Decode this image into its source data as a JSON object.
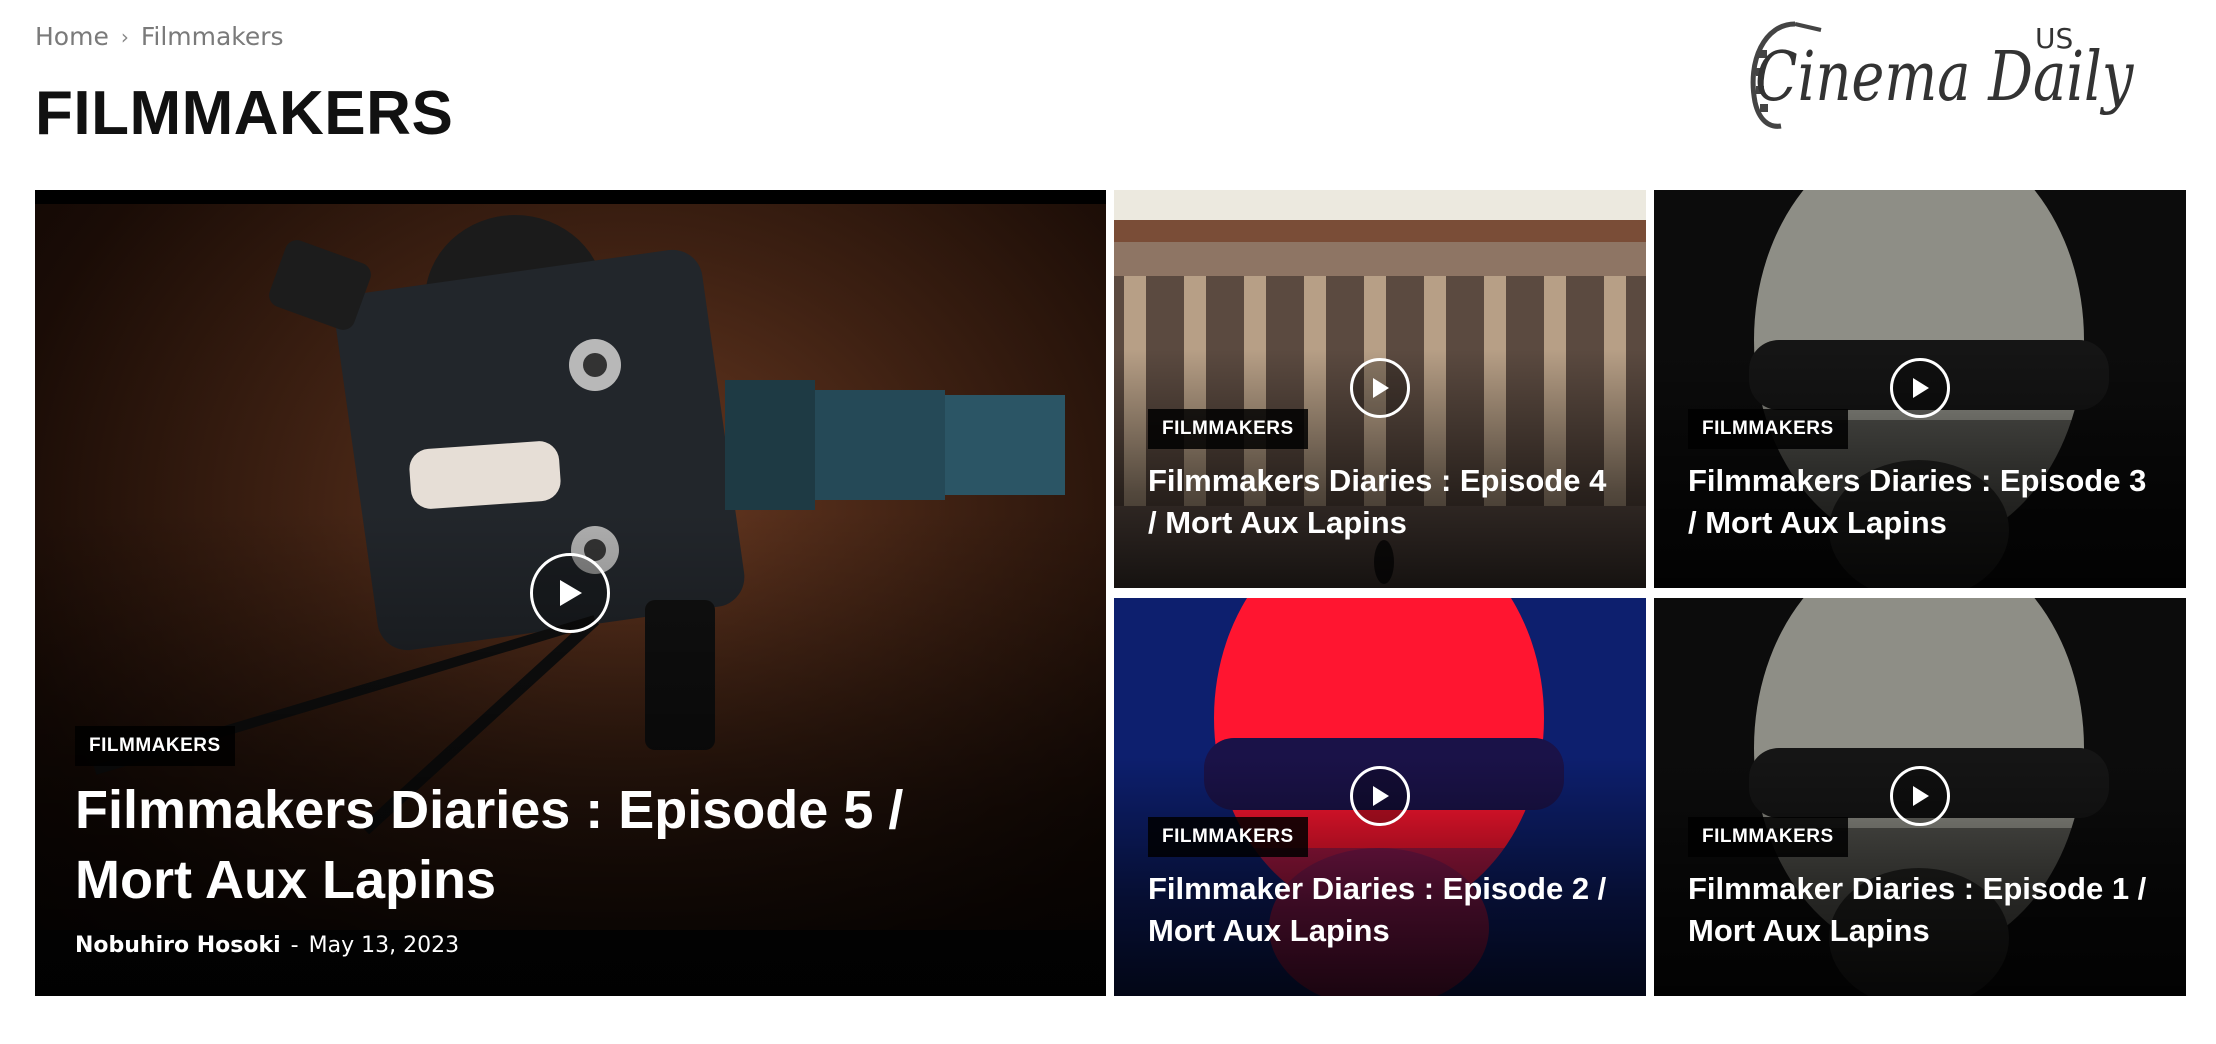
{
  "breadcrumb": {
    "home": "Home",
    "separator": "›",
    "current": "Filmmakers"
  },
  "page": {
    "title": "FILMMAKERS"
  },
  "logo": {
    "text": "Cinema Daily",
    "region": "US"
  },
  "posts": [
    {
      "category": "FILMMAKERS",
      "title": "Filmmakers Diaries : Episode 5 / Mort Aux Lapins",
      "author": "Nobuhiro Hosoki",
      "separator": "-",
      "date": "May 13, 2023",
      "image": "vintage-film-camera",
      "has_video": true
    },
    {
      "category": "FILMMAKERS",
      "title": "Filmmakers Diaries : Episode 4 / Mort Aux Lapins",
      "image": "columned-building",
      "has_video": true
    },
    {
      "category": "FILMMAKERS",
      "title": "Filmmakers Diaries : Episode 3 / Mort Aux Lapins",
      "image": "bald-man-sunglasses-grayscale",
      "has_video": true
    },
    {
      "category": "FILMMAKERS",
      "title": "Filmmaker Diaries : Episode 2 / Mort Aux Lapins",
      "image": "bald-man-sunglasses-red-blue",
      "has_video": true
    },
    {
      "category": "FILMMAKERS",
      "title": "Filmmaker Diaries : Episode 1 / Mort Aux Lapins",
      "image": "bald-man-sunglasses-grayscale",
      "has_video": true
    }
  ],
  "colors": {
    "category_badge_bg": "#000000",
    "overlay_text": "#ffffff",
    "title_text": "#111111",
    "breadcrumb_text": "#7a7a7a"
  },
  "icons": {
    "play": "play-icon"
  }
}
